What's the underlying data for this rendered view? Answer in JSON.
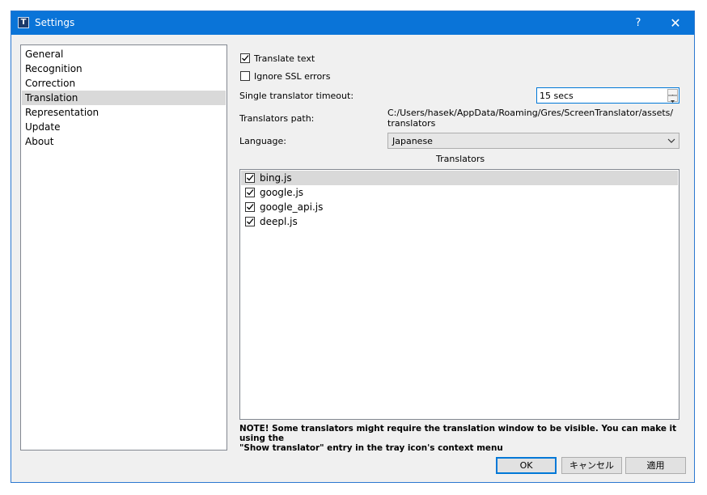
{
  "window": {
    "title": "Settings",
    "help_label": "?",
    "close_label": "✕",
    "app_icon_letter": "T"
  },
  "sidebar": {
    "items": [
      {
        "label": "General"
      },
      {
        "label": "Recognition"
      },
      {
        "label": "Correction"
      },
      {
        "label": "Translation",
        "selected": true
      },
      {
        "label": "Representation"
      },
      {
        "label": "Update"
      },
      {
        "label": "About"
      }
    ]
  },
  "translation": {
    "translate_text": {
      "label": "Translate text",
      "checked": true
    },
    "ignore_ssl": {
      "label": "Ignore SSL errors",
      "checked": false
    },
    "timeout": {
      "label": "Single translator timeout:",
      "value": "15 secs"
    },
    "path": {
      "label": "Translators path:",
      "line1": "C:/Users/hasek/AppData/Roaming/Gres/ScreenTranslator/assets/",
      "line2": "translators"
    },
    "language": {
      "label": "Language:",
      "value": "Japanese"
    },
    "translators_header": "Translators",
    "translators": [
      {
        "label": "bing.js",
        "checked": true,
        "selected": true
      },
      {
        "label": "google.js",
        "checked": true
      },
      {
        "label": "google_api.js",
        "checked": true
      },
      {
        "label": "deepl.js",
        "checked": true
      }
    ],
    "note_line1": "NOTE! Some translators might require the translation window to be visible. You can make it using the",
    "note_line2": "\"Show translator\" entry in the tray icon's context menu"
  },
  "buttons": {
    "ok": "OK",
    "cancel": "キャンセル",
    "apply": "適用"
  },
  "colors": {
    "titlebar": "#0a74d8",
    "selection": "#d9d9d9",
    "focus": "#0078d7"
  }
}
